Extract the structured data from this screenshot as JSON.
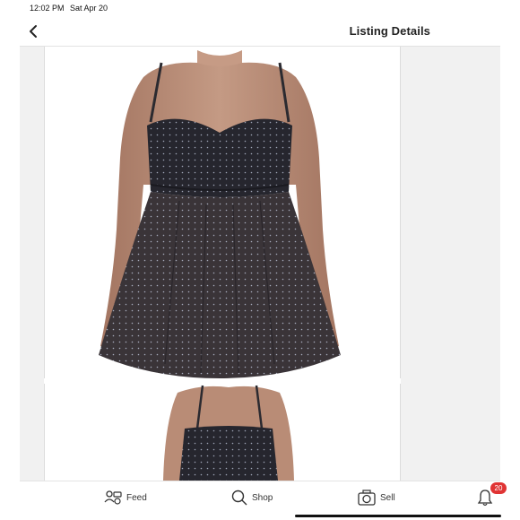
{
  "status_bar": {
    "time": "12:02 PM",
    "date": "Sat Apr 20"
  },
  "nav": {
    "title": "Listing Details",
    "back_icon": "chevron-left-icon"
  },
  "photos": [
    {
      "subject": "dress-front-view"
    },
    {
      "subject": "dress-back-view"
    }
  ],
  "tabs": [
    {
      "label": "Feed",
      "icon": "feed-icon"
    },
    {
      "label": "Shop",
      "icon": "search-icon"
    },
    {
      "label": "Sell",
      "icon": "camera-icon"
    },
    {
      "label": "",
      "icon": "bell-icon",
      "badge": "20"
    }
  ],
  "colors": {
    "badge": "#e03434",
    "dress": "#26262e",
    "dots": "#9fa6b8",
    "skin": "#b88a74"
  }
}
